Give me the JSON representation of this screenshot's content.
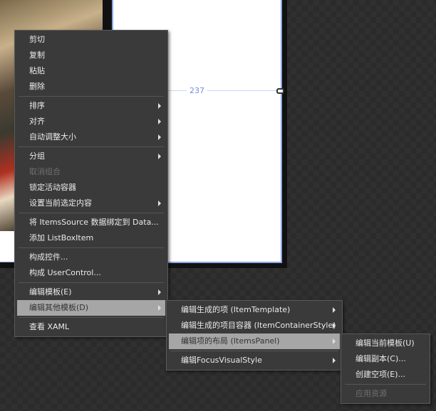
{
  "canvas": {
    "measure_label": "237"
  },
  "main_menu": {
    "items": [
      {
        "label": "剪切"
      },
      {
        "label": "复制"
      },
      {
        "label": "粘贴"
      },
      {
        "label": "删除"
      },
      {
        "label": "排序"
      },
      {
        "label": "对齐"
      },
      {
        "label": "自动调整大小"
      },
      {
        "label": "分组"
      },
      {
        "label": "取消组合"
      },
      {
        "label": "锁定活动容器"
      },
      {
        "label": "设置当前选定内容"
      },
      {
        "label": "将 ItemsSource 数据绑定到 Data..."
      },
      {
        "label": "添加 ListBoxItem"
      },
      {
        "label": "构成控件..."
      },
      {
        "label": "构成 UserControl..."
      },
      {
        "label": "编辑模板(E)"
      },
      {
        "label": "编辑其他模板(D)"
      },
      {
        "label": "查看 XAML"
      }
    ]
  },
  "submenu_other_templates": {
    "items": [
      {
        "label": "编辑生成的项 (ItemTemplate)"
      },
      {
        "label": "编辑生成的项目容器 (ItemContainerStyle)"
      },
      {
        "label": "编辑项的布局 (ItemsPanel)"
      },
      {
        "label": "编辑FocusVisualStyle"
      }
    ]
  },
  "submenu_items_panel": {
    "items": [
      {
        "label": "编辑当前模板(U)"
      },
      {
        "label": "编辑副本(C)..."
      },
      {
        "label": "创建空项(E)..."
      },
      {
        "label": "应用资源"
      }
    ]
  }
}
